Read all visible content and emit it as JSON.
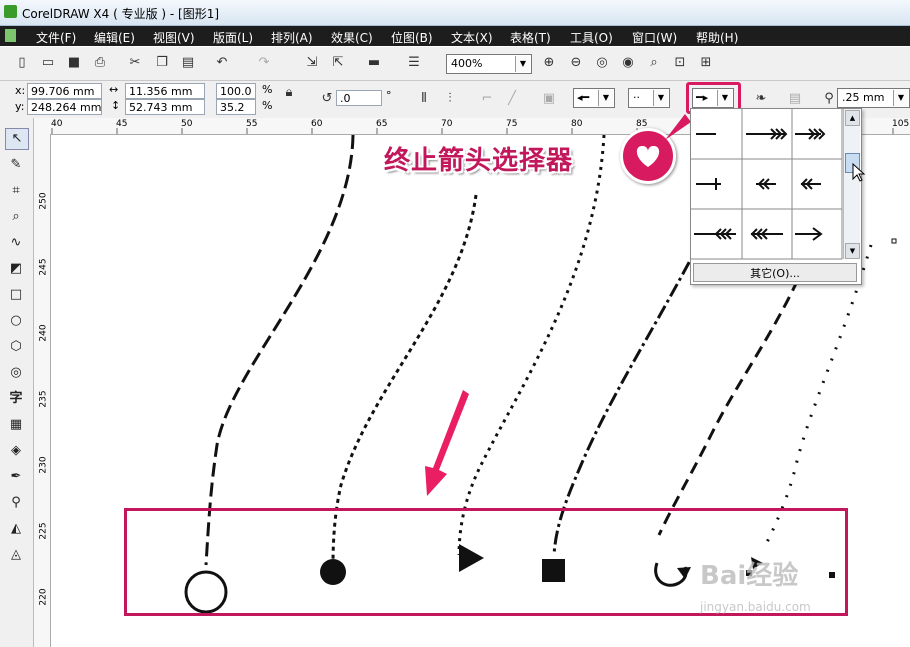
{
  "window": {
    "title": "CorelDRAW X4 ( 专业版 ) - [图形1]"
  },
  "menu": [
    "文件(F)",
    "编辑(E)",
    "视图(V)",
    "版面(L)",
    "排列(A)",
    "效果(C)",
    "位图(B)",
    "文本(X)",
    "表格(T)",
    "工具(O)",
    "窗口(W)",
    "帮助(H)"
  ],
  "toolbar": {
    "zoom": "400%"
  },
  "properties": {
    "x_label": "x:",
    "x": "99.706 mm",
    "y_label": "y:",
    "y": "248.264 mm",
    "width": "11.356 mm",
    "height": "52.743 mm",
    "scale_w": "100.0",
    "scale_h": "35.2",
    "percent": "%",
    "rotation": ".0",
    "degree": "°",
    "outline_width": ".25 mm"
  },
  "ruler_h": [
    "40",
    "45",
    "50",
    "55",
    "60",
    "65",
    "70",
    "75",
    "80",
    "85",
    "105"
  ],
  "ruler_v": [
    "250",
    "245",
    "240",
    "235",
    "230",
    "225",
    "220"
  ],
  "popup": {
    "other_button": "其它(O)..."
  },
  "annotations": {
    "callout": "终止箭头选择器"
  },
  "watermark": {
    "brand": "Bai经验",
    "url": "jingyan.baidu.com"
  },
  "colors": {
    "accent": "#c2185b",
    "menubar": "#1d1d1d"
  }
}
